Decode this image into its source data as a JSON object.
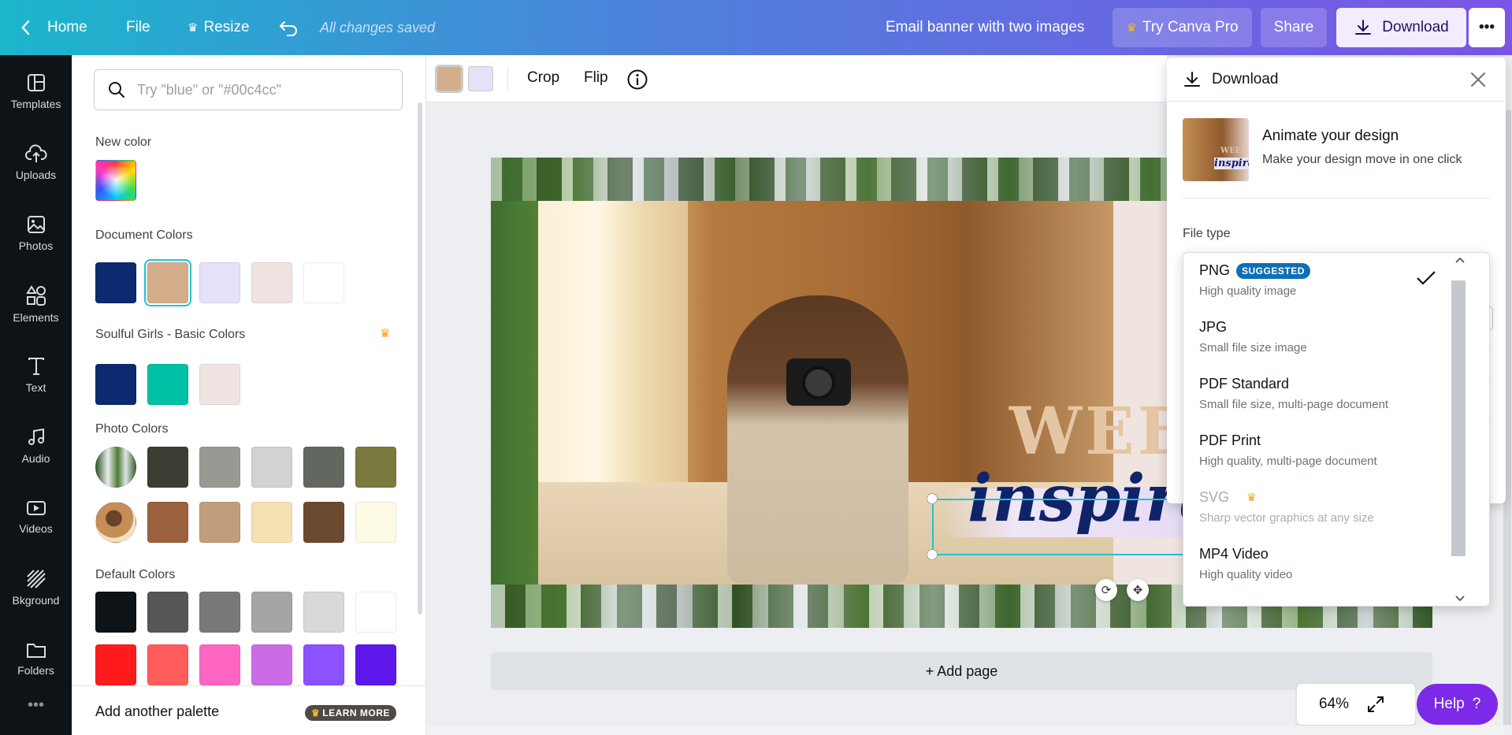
{
  "topbar": {
    "home": "Home",
    "file": "File",
    "resize": "Resize",
    "saved_status": "All changes saved",
    "design_title": "Email banner with two images",
    "try_pro": "Try Canva Pro",
    "share": "Share",
    "download": "Download",
    "more": "•••"
  },
  "rail": {
    "items": [
      {
        "label": "Templates",
        "icon": "templates-icon"
      },
      {
        "label": "Uploads",
        "icon": "upload-cloud-icon"
      },
      {
        "label": "Photos",
        "icon": "image-icon"
      },
      {
        "label": "Elements",
        "icon": "shapes-icon"
      },
      {
        "label": "Text",
        "icon": "text-icon"
      },
      {
        "label": "Audio",
        "icon": "music-note-icon"
      },
      {
        "label": "Videos",
        "icon": "video-icon"
      },
      {
        "label": "Bkground",
        "icon": "background-pattern-icon"
      },
      {
        "label": "Folders",
        "icon": "folder-icon"
      }
    ],
    "more": "•••"
  },
  "colors_panel": {
    "search_placeholder": "Try \"blue\" or \"#00c4cc\"",
    "new_color_title": "New color",
    "document_colors_title": "Document Colors",
    "document_colors": [
      "#0b2a6f",
      "#d4ae8a",
      "#e6e0f8",
      "#efe4e1",
      "#ffffff"
    ],
    "brand_palette_title": "Soulful Girls - Basic Colors",
    "brand_palette": [
      "#0b2a6f",
      "#00c0a5",
      "#efe4e1"
    ],
    "photo_colors_title": "Photo Colors",
    "photo_colors_row1": [
      "#3b3f33",
      "#999994",
      "#d2d2d3",
      "#626760",
      "#7a793e"
    ],
    "photo_colors_row2": [
      "#9b603d",
      "#c19e7b",
      "#f5e1b2",
      "#6c4a2f",
      "#fdfbe6"
    ],
    "default_colors_title": "Default Colors",
    "default_colors_row1": [
      "#0e1318",
      "#555755",
      "#777877",
      "#a5a5a5",
      "#d9d9da",
      "#ffffff"
    ],
    "default_colors_row2": [
      "#ff1b1b",
      "#ff5c5c",
      "#ff66c4",
      "#cb6ce6",
      "#8c52ff",
      "#5e17eb"
    ],
    "add_palette": "Add another palette",
    "learn_more": "LEARN MORE"
  },
  "toolbar": {
    "swatches": [
      "#d4ae8a",
      "#e6e0f8"
    ],
    "crop": "Crop",
    "flip": "Flip"
  },
  "canvas": {
    "weekly_text": "WEEKLY",
    "inspiration_text": "inspiration",
    "add_page": "+ Add page"
  },
  "zoom": {
    "level": "64%"
  },
  "help": {
    "label": "Help",
    "glyph": "?"
  },
  "download_panel": {
    "title": "Download",
    "animate_title": "Animate your design",
    "animate_subtitle": "Make your design move in one click",
    "animate_thumb_text_1": "WEEK",
    "animate_thumb_text_2": "inspirati",
    "file_type_label": "File type",
    "hidden_size_value": "1"
  },
  "file_types": [
    {
      "name": "PNG",
      "badge": "SUGGESTED",
      "desc": "High quality image",
      "selected": true,
      "disabled": false
    },
    {
      "name": "JPG",
      "desc": "Small file size image",
      "selected": false,
      "disabled": false
    },
    {
      "name": "PDF Standard",
      "desc": "Small file size, multi-page document",
      "selected": false,
      "disabled": false
    },
    {
      "name": "PDF Print",
      "desc": "High quality, multi-page document",
      "selected": false,
      "disabled": false
    },
    {
      "name": "SVG",
      "desc": "Sharp vector graphics at any size",
      "selected": false,
      "disabled": true,
      "pro": true
    },
    {
      "name": "MP4 Video",
      "desc": "High quality video",
      "selected": false,
      "disabled": false
    }
  ]
}
